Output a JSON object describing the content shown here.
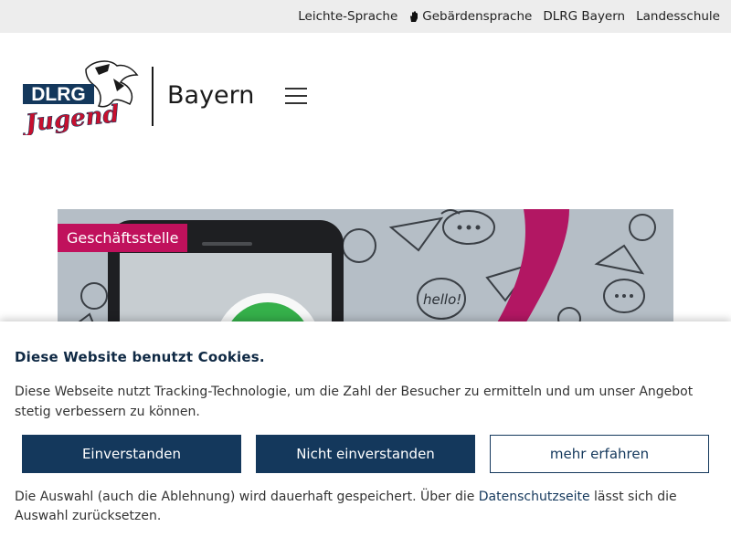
{
  "topbar": {
    "links": [
      "Leichte-Sprache",
      "Gebärdensprache",
      "DLRG Bayern",
      "Landesschule"
    ]
  },
  "header": {
    "logo_text": "DLRG",
    "logo_subtext": "Jugend",
    "brand_name": "Bayern",
    "menu_icon": "hamburger-icon"
  },
  "hero": {
    "tag": "Geschäftsstelle",
    "bubble_text": "hello!"
  },
  "cookie": {
    "title": "Diese Website benutzt Cookies.",
    "text": "Diese Webseite nutzt Tracking-Technologie, um die Zahl der Besucher zu ermitteln und um unser Angebot stetig verbessern zu können.",
    "accept": "Einverstanden",
    "decline": "Nicht einverstanden",
    "more": "mehr erfahren",
    "note_before": "Die Auswahl (auch die Ablehnung) wird dauerhaft gespeichert. Über die ",
    "note_link": "Datenschutzseite",
    "note_after": " lässt sich die Auswahl zurücksetzen."
  },
  "colors": {
    "navy": "#14385c",
    "magenta": "#c0115c",
    "logo_red": "#c8102e",
    "logo_blue": "#14385c"
  }
}
